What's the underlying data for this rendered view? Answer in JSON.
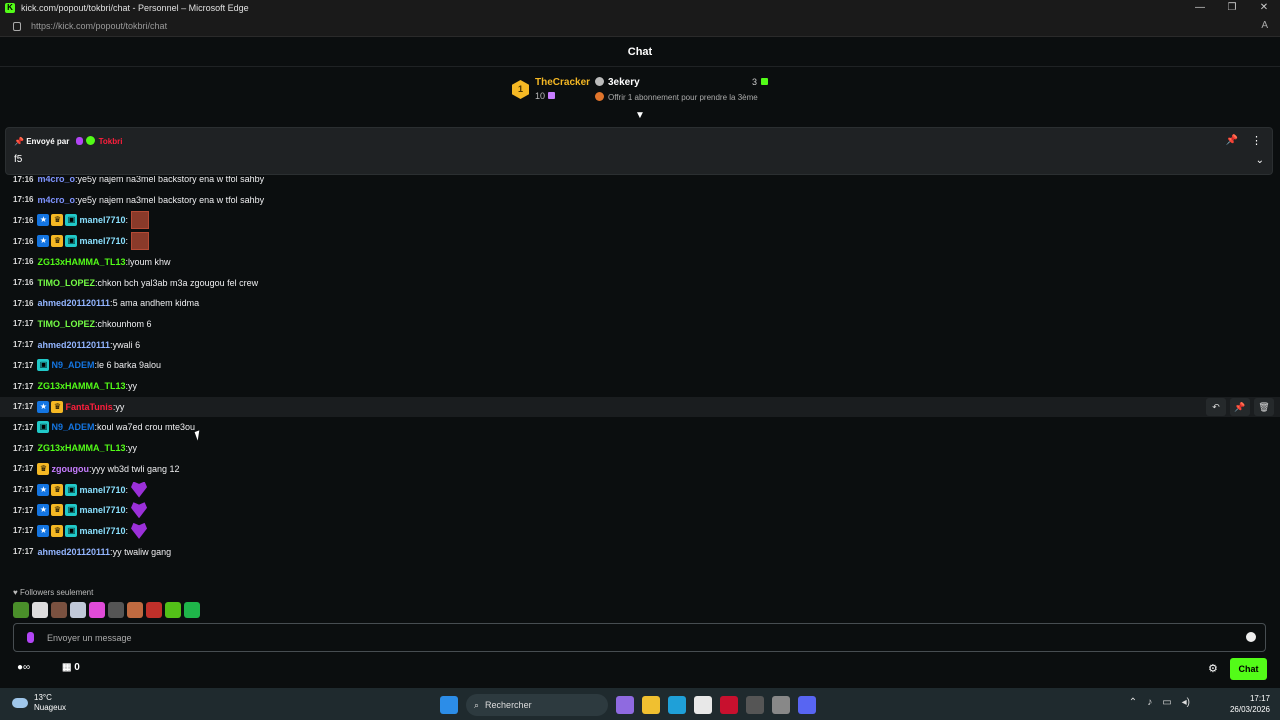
{
  "browser": {
    "window_title": "kick.com/popout/tokbri/chat - Personnel – Microsoft Edge",
    "url": "https://kick.com/popout/tokbri/chat",
    "controls": [
      "—",
      "❐",
      "✕"
    ]
  },
  "chat": {
    "header": "Chat",
    "leaderboard": {
      "rank": "1",
      "top_gifter": "TheCracker",
      "top_gifter_count": "10",
      "second_user": "3ekery",
      "second_count": "3",
      "offer_text": "Offrir 1 abonnement pour prendre la 3ème"
    },
    "pinned": {
      "sent_by_label": "Envoyé par",
      "sender": "Tokbri",
      "message": "f5"
    },
    "messages": [
      {
        "time": "17:16",
        "user": "m4cro_o",
        "color": "#7f94ff",
        "badges": [],
        "text": "ye5y najem na3mel backstory ena w tfol sahby",
        "emote": ""
      },
      {
        "time": "17:16",
        "user": "m4cro_o",
        "color": "#7f94ff",
        "badges": [],
        "text": "ye5y najem na3mel backstory ena w tfol sahby",
        "emote": ""
      },
      {
        "time": "17:16",
        "user": "manel7710",
        "color": "#8be1ff",
        "badges": [
          "blue",
          "gold",
          "teal"
        ],
        "text": "",
        "emote": "img"
      },
      {
        "time": "17:16",
        "user": "manel7710",
        "color": "#8be1ff",
        "badges": [
          "blue",
          "gold",
          "teal"
        ],
        "text": "",
        "emote": "img"
      },
      {
        "time": "17:16",
        "user": "ZG13xHAMMA_TL13",
        "color": "#53fc18",
        "badges": [],
        "text": "lyoum khw",
        "emote": ""
      },
      {
        "time": "17:16",
        "user": "TIMO_LOPEZ",
        "color": "#75fd46",
        "badges": [],
        "text": "chkon bch yal3ab m3a zgougou fel crew",
        "emote": ""
      },
      {
        "time": "17:16",
        "user": "ahmed201120111",
        "color": "#93b5ff",
        "badges": [],
        "text": "5 ama andhem kidma",
        "emote": ""
      },
      {
        "time": "17:17",
        "user": "TIMO_LOPEZ",
        "color": "#75fd46",
        "badges": [],
        "text": "chkounhom 6",
        "emote": ""
      },
      {
        "time": "17:17",
        "user": "ahmed201120111",
        "color": "#93b5ff",
        "badges": [],
        "text": "ywali 6",
        "emote": ""
      },
      {
        "time": "17:17",
        "user": "N9_ADEM",
        "color": "#1475e1",
        "badges": [
          "teal"
        ],
        "text": "le 6 barka 9alou",
        "emote": ""
      },
      {
        "time": "17:17",
        "user": "ZG13xHAMMA_TL13",
        "color": "#53fc18",
        "badges": [],
        "text": "yy",
        "emote": ""
      },
      {
        "time": "17:17",
        "user": "FantaTunis",
        "color": "#ff1e3c",
        "badges": [
          "blue",
          "gold"
        ],
        "text": "yy",
        "emote": ""
      },
      {
        "time": "17:17",
        "user": "N9_ADEM",
        "color": "#1475e1",
        "badges": [
          "teal"
        ],
        "text": "koul wa7ed crou mte3ou",
        "emote": ""
      },
      {
        "time": "17:17",
        "user": "ZG13xHAMMA_TL13",
        "color": "#53fc18",
        "badges": [],
        "text": "yy",
        "emote": ""
      },
      {
        "time": "17:17",
        "user": "zgougou",
        "color": "#c77dff",
        "badges": [
          "gold"
        ],
        "text": "yyy wb3d twli gang 12",
        "emote": ""
      },
      {
        "time": "17:17",
        "user": "manel7710",
        "color": "#8be1ff",
        "badges": [
          "blue",
          "gold",
          "teal"
        ],
        "text": "",
        "emote": "heart"
      },
      {
        "time": "17:17",
        "user": "manel7710",
        "color": "#8be1ff",
        "badges": [
          "blue",
          "gold",
          "teal"
        ],
        "text": "",
        "emote": "heart"
      },
      {
        "time": "17:17",
        "user": "manel7710",
        "color": "#8be1ff",
        "badges": [
          "blue",
          "gold",
          "teal"
        ],
        "text": "",
        "emote": "heart"
      },
      {
        "time": "17:17",
        "user": "ahmed201120111",
        "color": "#93b5ff",
        "badges": [],
        "text": "yy twaliw gang",
        "emote": ""
      }
    ],
    "followers_label": "Followers seulement",
    "input_placeholder": "Envoyer un message",
    "points": "0",
    "send_label": "Chat"
  },
  "taskbar": {
    "temperature": "13°C",
    "weather": "Nuageux",
    "search_label": "Rechercher",
    "time": "17:17",
    "date": "26/03/2026"
  }
}
